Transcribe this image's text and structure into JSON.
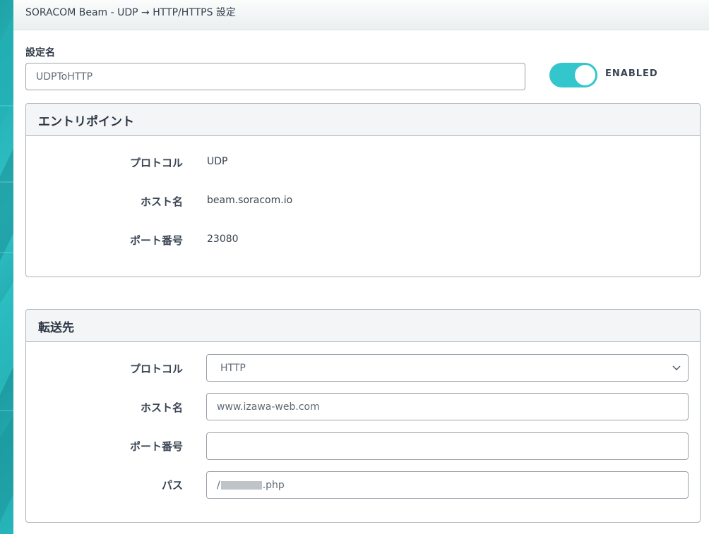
{
  "header": {
    "title": "SORACOM Beam - UDP → HTTP/HTTPS 設定"
  },
  "setting": {
    "label": "設定名",
    "name_value": "UDPToHTTP",
    "toggle_label": "ENABLED",
    "enabled": true
  },
  "entrypoint": {
    "title": "エントリポイント",
    "rows": [
      {
        "label": "プロトコル",
        "value": "UDP"
      },
      {
        "label": "ホスト名",
        "value": "beam.soracom.io"
      },
      {
        "label": "ポート番号",
        "value": "23080"
      }
    ]
  },
  "destination": {
    "title": "転送先",
    "protocol": {
      "label": "プロトコル",
      "value": "HTTP"
    },
    "host": {
      "label": "ホスト名",
      "value": "www.izawa-web.com"
    },
    "port": {
      "label": "ポート番号",
      "value": ""
    },
    "path": {
      "label": "パス",
      "prefix": "/",
      "suffix": ".php"
    }
  },
  "colors": {
    "accent": "#33c6cd",
    "sidebar": "#1fa3a8"
  }
}
